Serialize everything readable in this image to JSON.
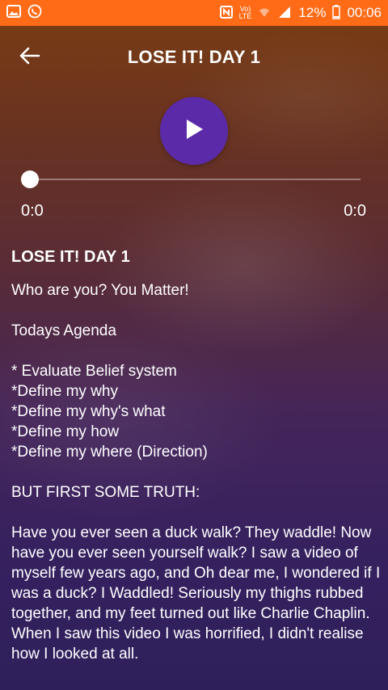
{
  "status_bar": {
    "battery": "12%",
    "time": "00:06",
    "network": "LTE"
  },
  "header": {
    "title": "LOSE IT! DAY 1"
  },
  "player": {
    "current_time": "0:0",
    "total_time": "0:0",
    "progress": 0
  },
  "content": {
    "heading": "LOSE IT! DAY 1",
    "line1": "Who are you? You Matter!",
    "agenda_title": "Todays Agenda",
    "agenda_items": [
      "* Evaluate Belief system",
      "*Define my why",
      "*Define my why's what",
      "*Define my how",
      "*Define my where (Direction)"
    ],
    "truth_title": "BUT FIRST SOME TRUTH:",
    "paragraph": "Have you ever seen a duck walk? They waddle! Now have you ever seen yourself walk? I saw a video of myself few years ago, and Oh dear me, I wondered if I was a duck? I Waddled! Seriously my thighs rubbed together, and my feet turned out like Charlie Chaplin. When I saw this video I was horrified, I didn't realise how I looked at all."
  },
  "colors": {
    "status_bar": "#ff6b17",
    "play_button": "#5b2aa8"
  },
  "icons": [
    "gallery-icon",
    "whatsapp-icon",
    "nfc-icon",
    "volte-icon",
    "wifi-icon",
    "signal-icon",
    "battery-icon",
    "back-arrow-icon",
    "play-icon"
  ]
}
